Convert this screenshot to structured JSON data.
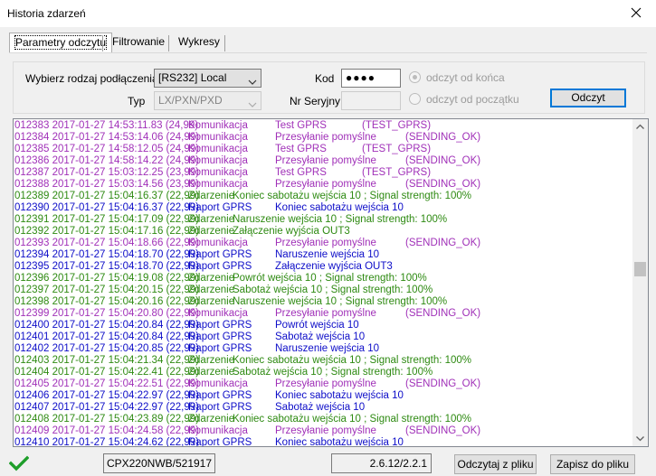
{
  "window": {
    "title": "Historia zdarzeń"
  },
  "tabs": [
    {
      "label": "Parametry odczytu"
    },
    {
      "label": "Filtrowanie"
    },
    {
      "label": "Wykresy"
    }
  ],
  "form": {
    "connection_label": "Wybierz rodzaj podłączenia",
    "connection_value": "[RS232] Local",
    "type_label": "Typ",
    "type_value": "LX/PXN/PXD",
    "code_label": "Kod",
    "code_value": "●●●●",
    "serial_label": "Nr Seryjny",
    "serial_value": "",
    "radio_from_end": "odczyt od końca",
    "radio_from_start": "odczyt od początku",
    "read_button": "Odczyt"
  },
  "colors": {
    "purple": "#a030b8",
    "blue": "#0d0dc8",
    "green": "#2e8a12"
  },
  "log": [
    {
      "id": "012383",
      "ts": "2017-01-27 14:53:11.83 (24,99)",
      "type": "Komunikacja",
      "desc": "Test GPRS",
      "code": "(TEST_GPRS)",
      "color": "purple"
    },
    {
      "id": "012384",
      "ts": "2017-01-27 14:53:14.06 (24,99)",
      "type": "Komunikacja",
      "desc": "Przesyłanie pomyślne",
      "code": "(SENDING_OK)",
      "color": "purple"
    },
    {
      "id": "012385",
      "ts": "2017-01-27 14:58:12.05 (24,99)",
      "type": "Komunikacja",
      "desc": "Test GPRS",
      "code": "(TEST_GPRS)",
      "color": "purple"
    },
    {
      "id": "012386",
      "ts": "2017-01-27 14:58:14.22 (24,99)",
      "type": "Komunikacja",
      "desc": "Przesyłanie pomyślne",
      "code": "(SENDING_OK)",
      "color": "purple"
    },
    {
      "id": "012387",
      "ts": "2017-01-27 15:03:12.25 (23,99)",
      "type": "Komunikacja",
      "desc": "Test GPRS",
      "code": "(TEST_GPRS)",
      "color": "purple"
    },
    {
      "id": "012388",
      "ts": "2017-01-27 15:03:14.56 (23,99)",
      "type": "Komunikacja",
      "desc": "Przesyłanie pomyślne",
      "code": "(SENDING_OK)",
      "color": "purple"
    },
    {
      "id": "012389",
      "ts": "2017-01-27 15:04:16.37 (22,99)",
      "type": "Zdarzenie",
      "desc": "Koniec sabotażu wejścia 10 ; Signal strength: 100%",
      "code": "",
      "color": "green"
    },
    {
      "id": "012390",
      "ts": "2017-01-27 15:04:16.37 (22,99)",
      "type": "Raport GPRS",
      "desc": "Koniec sabotażu wejścia 10",
      "code": "",
      "color": "blue"
    },
    {
      "id": "012391",
      "ts": "2017-01-27 15:04:17.09 (22,99)",
      "type": "Zdarzenie",
      "desc": "Naruszenie wejścia 10 ; Signal strength: 100%",
      "code": "",
      "color": "green"
    },
    {
      "id": "012392",
      "ts": "2017-01-27 15:04:17.16 (22,99)",
      "type": "Zdarzenie",
      "desc": "Załączenie wyjścia OUT3",
      "code": "",
      "color": "green"
    },
    {
      "id": "012393",
      "ts": "2017-01-27 15:04:18.66 (22,99)",
      "type": "Komunikacja",
      "desc": "Przesyłanie pomyślne",
      "code": "(SENDING_OK)",
      "color": "purple"
    },
    {
      "id": "012394",
      "ts": "2017-01-27 15:04:18.70 (22,99)",
      "type": "Raport GPRS",
      "desc": "Naruszenie wejścia 10",
      "code": "",
      "color": "blue"
    },
    {
      "id": "012395",
      "ts": "2017-01-27 15:04:18.70 (22,99)",
      "type": "Raport GPRS",
      "desc": "Załączenie wyjścia OUT3",
      "code": "",
      "color": "blue"
    },
    {
      "id": "012396",
      "ts": "2017-01-27 15:04:19.08 (22,99)",
      "type": "Zdarzenie",
      "desc": "Powrót wejścia 10 ; Signal strength: 100%",
      "code": "",
      "color": "green"
    },
    {
      "id": "012397",
      "ts": "2017-01-27 15:04:20.15 (22,99)",
      "type": "Zdarzenie",
      "desc": "Sabotaż wejścia 10 ; Signal strength: 100%",
      "code": "",
      "color": "green"
    },
    {
      "id": "012398",
      "ts": "2017-01-27 15:04:20.16 (22,99)",
      "type": "Zdarzenie",
      "desc": "Naruszenie wejścia 10 ; Signal strength: 100%",
      "code": "",
      "color": "green"
    },
    {
      "id": "012399",
      "ts": "2017-01-27 15:04:20.80 (22,99)",
      "type": "Komunikacja",
      "desc": "Przesyłanie pomyślne",
      "code": "(SENDING_OK)",
      "color": "purple"
    },
    {
      "id": "012400",
      "ts": "2017-01-27 15:04:20.84 (22,99)",
      "type": "Raport GPRS",
      "desc": "Powrót wejścia 10",
      "code": "",
      "color": "blue"
    },
    {
      "id": "012401",
      "ts": "2017-01-27 15:04:20.84 (22,99)",
      "type": "Raport GPRS",
      "desc": "Sabotaż wejścia 10",
      "code": "",
      "color": "blue"
    },
    {
      "id": "012402",
      "ts": "2017-01-27 15:04:20.85 (22,99)",
      "type": "Raport GPRS",
      "desc": "Naruszenie wejścia 10",
      "code": "",
      "color": "blue"
    },
    {
      "id": "012403",
      "ts": "2017-01-27 15:04:21.34 (22,99)",
      "type": "Zdarzenie",
      "desc": "Koniec sabotażu wejścia 10 ; Signal strength: 100%",
      "code": "",
      "color": "green"
    },
    {
      "id": "012404",
      "ts": "2017-01-27 15:04:22.41 (22,99)",
      "type": "Zdarzenie",
      "desc": "Sabotaż wejścia 10 ; Signal strength: 100%",
      "code": "",
      "color": "green"
    },
    {
      "id": "012405",
      "ts": "2017-01-27 15:04:22.51 (22,99)",
      "type": "Komunikacja",
      "desc": "Przesyłanie pomyślne",
      "code": "(SENDING_OK)",
      "color": "purple"
    },
    {
      "id": "012406",
      "ts": "2017-01-27 15:04:22.97 (22,99)",
      "type": "Raport GPRS",
      "desc": "Koniec sabotażu wejścia 10",
      "code": "",
      "color": "blue"
    },
    {
      "id": "012407",
      "ts": "2017-01-27 15:04:22.97 (22,99)",
      "type": "Raport GPRS",
      "desc": "Sabotaż wejścia 10",
      "code": "",
      "color": "blue"
    },
    {
      "id": "012408",
      "ts": "2017-01-27 15:04:23.89 (22,99)",
      "type": "Zdarzenie",
      "desc": "Koniec sabotażu wejścia 10 ; Signal strength: 100%",
      "code": "",
      "color": "green"
    },
    {
      "id": "012409",
      "ts": "2017-01-27 15:04:24.58 (22,99)",
      "type": "Komunikacja",
      "desc": "Przesyłanie pomyślne",
      "code": "(SENDING_OK)",
      "color": "purple"
    },
    {
      "id": "012410",
      "ts": "2017-01-27 15:04:24.62 (22,99)",
      "type": "Raport GPRS",
      "desc": "Koniec sabotażu wejścia 10",
      "code": "",
      "color": "blue"
    }
  ],
  "status": {
    "device": "CPX220NWB/521917",
    "version": "2.6.12/2.2.1",
    "read_file_button": "Odczytaj z pliku",
    "save_file_button": "Zapisz do pliku"
  }
}
